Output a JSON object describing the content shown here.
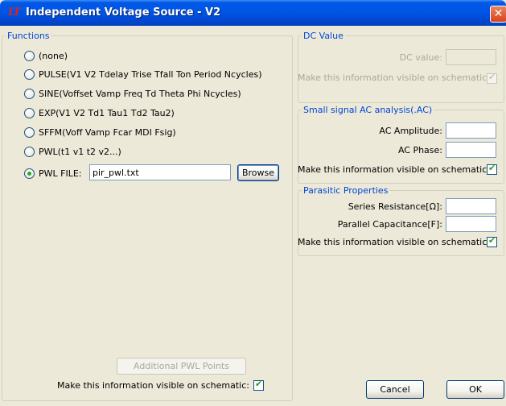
{
  "window": {
    "icon_text": "LT",
    "title": "Independent Voltage Source - V2",
    "close_glyph": "✕"
  },
  "functions": {
    "legend": "Functions",
    "options": [
      {
        "label": "(none)",
        "checked": false
      },
      {
        "label": "PULSE(V1 V2 Tdelay Trise Tfall Ton Period Ncycles)",
        "checked": false
      },
      {
        "label": "SINE(Voffset Vamp Freq Td Theta Phi Ncycles)",
        "checked": false
      },
      {
        "label": "EXP(V1 V2 Td1 Tau1 Td2 Tau2)",
        "checked": false
      },
      {
        "label": "SFFM(Voff Vamp Fcar MDI Fsig)",
        "checked": false
      },
      {
        "label": "PWL(t1 v1 t2 v2...)",
        "checked": false
      },
      {
        "label": "PWL FILE:",
        "checked": true
      }
    ],
    "pwl_file_value": "pir_pwl.txt",
    "browse_label": "Browse",
    "additional_pwl_label": "Additional PWL Points",
    "visible_label": "Make this information visible on schematic:",
    "visible_checked": true
  },
  "dc_value": {
    "legend": "DC Value",
    "value_label": "DC value:",
    "value": "",
    "visible_label": "Make this information visible on schematic:",
    "visible_checked": true
  },
  "ac_analysis": {
    "legend": "Small signal AC analysis(.AC)",
    "amplitude_label": "AC Amplitude:",
    "amplitude_value": "",
    "phase_label": "AC Phase:",
    "phase_value": "",
    "visible_label": "Make this information visible on schematic:",
    "visible_checked": true
  },
  "parasitic": {
    "legend": "Parasitic Properties",
    "series_label": "Series Resistance[Ω]:",
    "series_value": "",
    "parallel_label": "Parallel Capacitance[F]:",
    "parallel_value": "",
    "visible_label": "Make this information visible on schematic:",
    "visible_checked": true
  },
  "buttons": {
    "cancel": "Cancel",
    "ok": "OK"
  }
}
